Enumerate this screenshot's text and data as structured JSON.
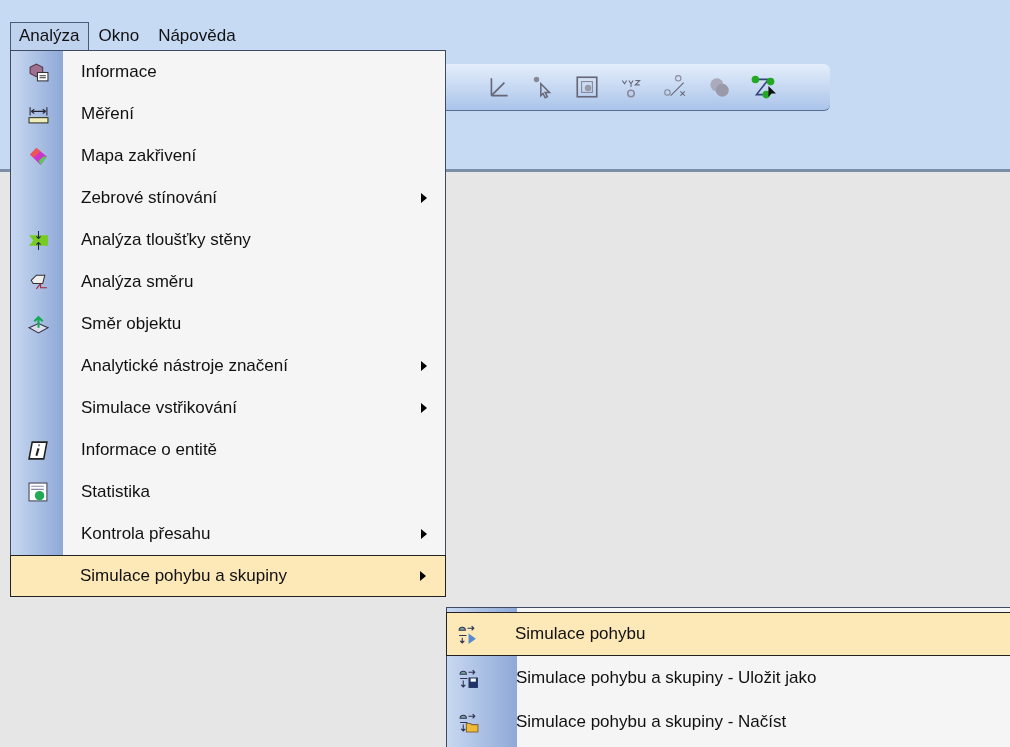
{
  "menubar": [
    {
      "label": "Analýza",
      "selected": true
    },
    {
      "label": "Okno",
      "selected": false
    },
    {
      "label": "Nápověda",
      "selected": false
    }
  ],
  "menu": {
    "items": [
      {
        "label": "Informace",
        "submenu": false,
        "selected": false
      },
      {
        "label": "Měření",
        "submenu": false,
        "selected": false
      },
      {
        "label": "Mapa zakřivení",
        "submenu": false,
        "selected": false
      },
      {
        "label": "Zebrové stínování",
        "submenu": true,
        "selected": false
      },
      {
        "label": "Analýza tloušťky stěny",
        "submenu": false,
        "selected": false
      },
      {
        "label": "Analýza směru",
        "submenu": false,
        "selected": false
      },
      {
        "label": "Směr objektu",
        "submenu": false,
        "selected": false
      },
      {
        "label": "Analytické nástroje značení",
        "submenu": true,
        "selected": false
      },
      {
        "label": "Simulace vstřikování",
        "submenu": true,
        "selected": false
      },
      {
        "label": "Informace o entitě",
        "submenu": false,
        "selected": false
      },
      {
        "label": "Statistika",
        "submenu": false,
        "selected": false
      },
      {
        "label": "Kontrola přesahu",
        "submenu": true,
        "selected": false
      },
      {
        "label": "Simulace pohybu a skupiny",
        "submenu": true,
        "selected": true
      }
    ]
  },
  "submenu": {
    "items": [
      {
        "label": "Simulace pohybu",
        "selected": true
      },
      {
        "label": "Simulace pohybu a skupiny - Uložit jako",
        "selected": false
      },
      {
        "label": "Simulace pohybu a skupiny - Načíst",
        "selected": false
      }
    ]
  }
}
